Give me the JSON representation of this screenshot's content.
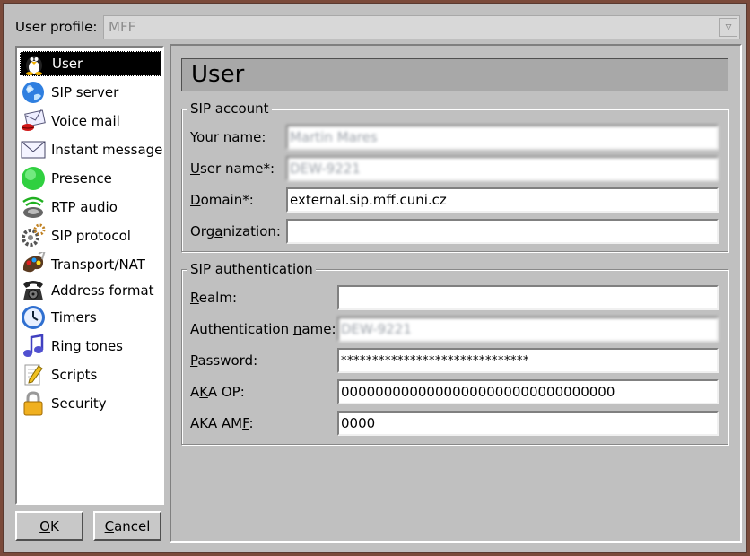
{
  "profile": {
    "label_before": "User profile:",
    "value": "MFF",
    "arrow_glyph": "▿"
  },
  "sidebar": {
    "items": [
      {
        "label": "User",
        "icon": "penguin-icon",
        "selected": true
      },
      {
        "label": "SIP server",
        "icon": "globe-icon"
      },
      {
        "label": "Voice mail",
        "icon": "envelope-lips-icon"
      },
      {
        "label": "Instant message",
        "icon": "envelope-icon"
      },
      {
        "label": "Presence",
        "icon": "green-circle-icon"
      },
      {
        "label": "RTP audio",
        "icon": "speaker-icon"
      },
      {
        "label": "SIP protocol",
        "icon": "gears-icon"
      },
      {
        "label": "Transport/NAT",
        "icon": "palette-icon"
      },
      {
        "label": "Address format",
        "icon": "telephone-icon"
      },
      {
        "label": "Timers",
        "icon": "clock-icon"
      },
      {
        "label": "Ring tones",
        "icon": "music-note-icon"
      },
      {
        "label": "Scripts",
        "icon": "script-pencil-icon"
      },
      {
        "label": "Security",
        "icon": "padlock-icon"
      }
    ]
  },
  "buttons": {
    "ok": {
      "mnemonic": "O",
      "rest": "K"
    },
    "cancel": {
      "mnemonic": "C",
      "rest": "ancel"
    }
  },
  "page": {
    "title": "User"
  },
  "sip_account": {
    "title": "SIP account",
    "your_name": {
      "pre": "",
      "mn": "Y",
      "post": "our name:",
      "value": "Martin Mares"
    },
    "user_name": {
      "pre": "",
      "mn": "U",
      "post": "ser name*:",
      "value": "DEW-9221"
    },
    "domain": {
      "pre": "",
      "mn": "D",
      "post": "omain*:",
      "value": "external.sip.mff.cuni.cz"
    },
    "organization": {
      "pre": "Org",
      "mn": "a",
      "post": "nization:",
      "value": ""
    }
  },
  "sip_auth": {
    "title": "SIP authentication",
    "realm": {
      "pre": "",
      "mn": "R",
      "post": "ealm:",
      "value": ""
    },
    "auth_name": {
      "pre": "Authentication ",
      "mn": "n",
      "post": "ame:",
      "value": "DEW-9221"
    },
    "password": {
      "pre": "",
      "mn": "P",
      "post": "assword:",
      "value": "******************************"
    },
    "aka_op": {
      "pre": "A",
      "mn": "K",
      "post": "A OP:",
      "value": "00000000000000000000000000000000"
    },
    "aka_amf": {
      "pre": "AKA AM",
      "mn": "F",
      "post": ":",
      "value": "0000"
    }
  },
  "colors": {
    "window_bg": "#c0c0c0",
    "selection_bg": "#000000",
    "title_bar_bg": "#a8a8a8"
  }
}
